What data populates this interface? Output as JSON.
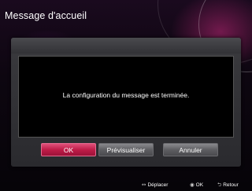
{
  "header": {
    "title": "Message d'accueil"
  },
  "dialog": {
    "message": "La configuration du message est terminée.",
    "buttons": [
      {
        "label": "OK",
        "selected": true
      },
      {
        "label": "Prévisualiser",
        "selected": false
      },
      {
        "label": "Annuler",
        "selected": false
      }
    ]
  },
  "footer": {
    "hints": [
      {
        "icon": "left-right-arrows-icon",
        "glyph": "↔",
        "label": "Déplacer"
      },
      {
        "icon": "ok-circle-icon",
        "glyph": "◉",
        "label": "OK"
      },
      {
        "icon": "return-arrow-icon",
        "glyph": "⮌",
        "label": "Retour"
      }
    ]
  },
  "colors": {
    "accent": "#c01c48",
    "button": "#5e5e62"
  }
}
